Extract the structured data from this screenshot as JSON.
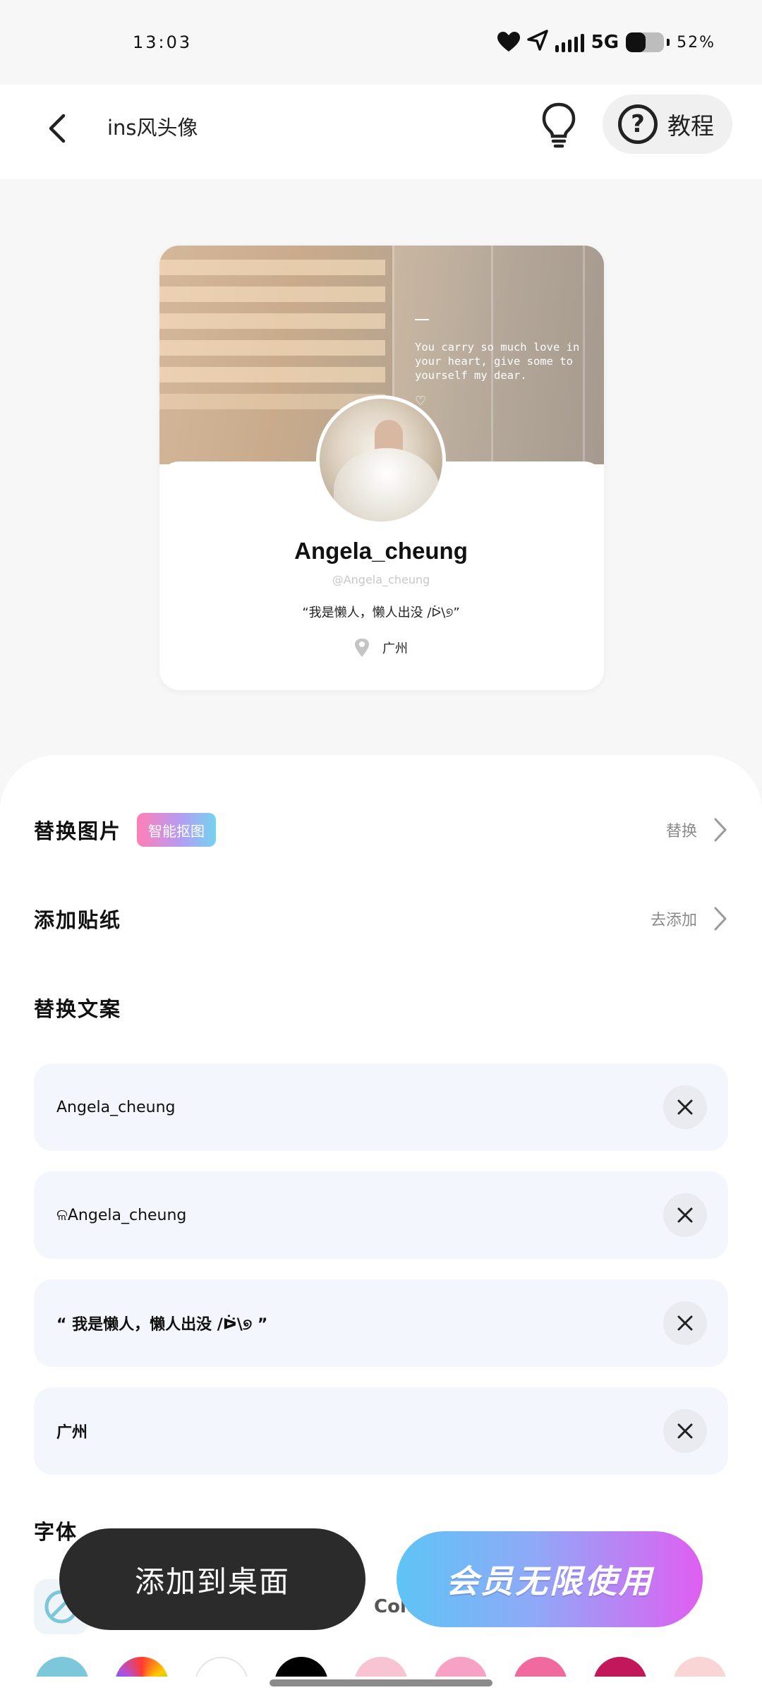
{
  "status_bar": {
    "time": "13:03",
    "network": "5G",
    "battery": "52%",
    "battery_level": 0.52
  },
  "header": {
    "title": "ins风头像",
    "tutorial_label": "教程",
    "tutorial_icon": "?"
  },
  "preview": {
    "cover_quote": "You carry so much love in your heart, give some to yourself my dear.",
    "cover_heart": "♡",
    "name": "Angela_cheung",
    "handle": "@Angela_cheung",
    "bio": "“我是懒人，懒人出没 /ᐖ\\୭”",
    "location": "广州"
  },
  "settings": {
    "replace_image": {
      "title": "替换图片",
      "badge": "智能抠图",
      "action": "替换"
    },
    "add_sticker": {
      "title": "添加贴纸",
      "action": "去添加"
    },
    "replace_text": {
      "title": "替换文案",
      "fields": [
        "Angela_cheung",
        "ଳAngela_cheung",
        "“ 我是懒人，懒人出没 /ᐖ\\୭ ”",
        "广州"
      ]
    },
    "font": {
      "title": "字体",
      "color_label": "Colo"
    }
  },
  "swatches": [
    "#7cc7d9",
    "#f5a623",
    "#ffffff",
    "#000000",
    "#f8c3d3",
    "#f7a1c4",
    "#f06aa0",
    "#c2185b",
    "#f9d5d5"
  ],
  "buttons": {
    "add_to_desktop": "添加到桌面",
    "vip_unlimited": "会员无限使用"
  }
}
